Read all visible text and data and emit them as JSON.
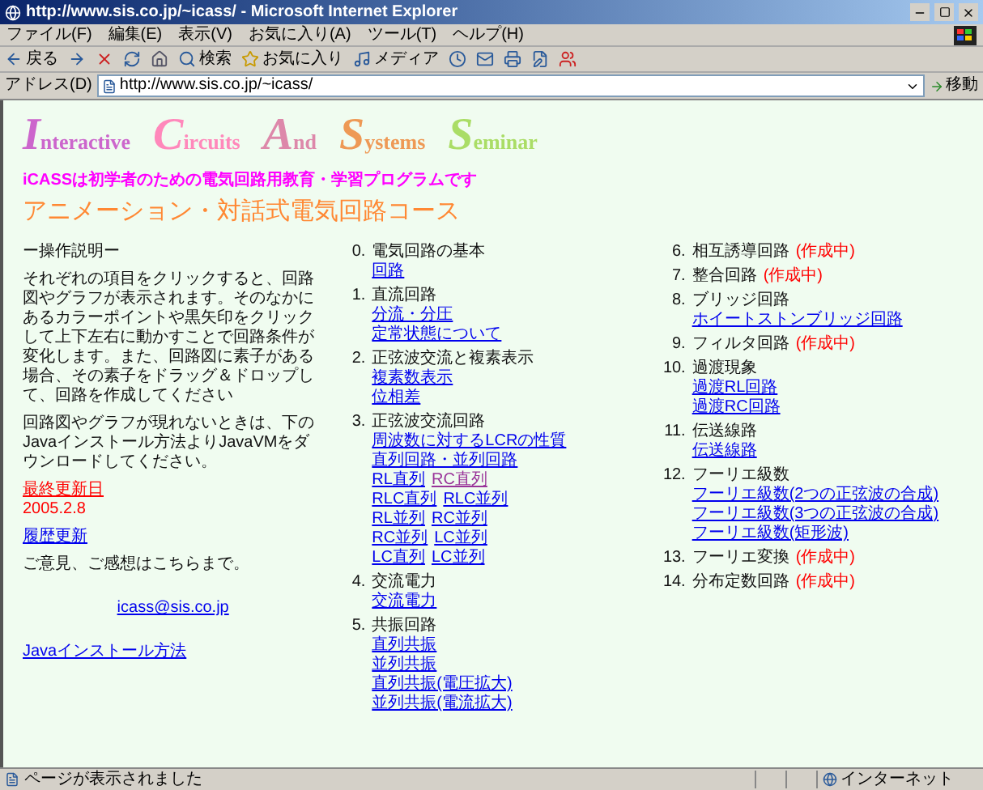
{
  "window": {
    "title": "http://www.sis.co.jp/~icass/ - Microsoft Internet Explorer"
  },
  "menu": [
    "ファイル(F)",
    "編集(E)",
    "表示(V)",
    "お気に入り(A)",
    "ツール(T)",
    "ヘルプ(H)"
  ],
  "toolbar": [
    {
      "kind": "back",
      "label": "戻る"
    },
    {
      "kind": "forward"
    },
    {
      "kind": "stop"
    },
    {
      "kind": "refresh"
    },
    {
      "kind": "home"
    },
    {
      "kind": "search",
      "label": "検索"
    },
    {
      "kind": "favorites",
      "label": "お気に入り"
    },
    {
      "kind": "media",
      "label": "メディア"
    },
    {
      "kind": "history"
    },
    {
      "kind": "mail"
    },
    {
      "kind": "print"
    },
    {
      "kind": "edit"
    },
    {
      "kind": "messenger"
    }
  ],
  "address": {
    "label": "アドレス(D)",
    "value": "http://www.sis.co.jp/~icass/",
    "go": "移動"
  },
  "page": {
    "logo": [
      {
        "word": "Interactive",
        "color": "#cc66cc"
      },
      {
        "word": "Circuits",
        "color": "#ff88bb"
      },
      {
        "word": "And",
        "color": "#dd88aa"
      },
      {
        "word": "Systems",
        "color": "#ee9955"
      },
      {
        "word": "Seminar",
        "color": "#aadd66"
      }
    ],
    "tagline": "iCASSは初学者のための電気回路用教育・学習プログラムです",
    "heading": "アニメーション・対話式電気回路コース",
    "left": [
      {
        "kind": "text",
        "text": "ー操作説明ー"
      },
      {
        "kind": "text",
        "text": "それぞれの項目をクリックすると、回路図やグラフが表示されます。そのなかにあるカラーポイントや黒矢印をクリックして上下左右に動かすことで回路条件が変化します。また、回路図に素子がある場合、その素子をドラッグ＆ドロップして、回路を作成してください"
      },
      {
        "kind": "text",
        "text": "回路図やグラフが現れないときは、下のJavaインストール方法よりJavaVMをダウンロードしてください。"
      },
      {
        "kind": "red",
        "text": "最終更新日"
      },
      {
        "kind": "red_small",
        "text": "2005.2.8"
      },
      {
        "kind": "link",
        "text": "履歴更新"
      },
      {
        "kind": "text",
        "text": "ご意見、ご感想はこちらまで。"
      },
      {
        "kind": "mail",
        "text": "icass@sis.co.jp"
      },
      {
        "kind": "link",
        "text": "Javaインストール方法"
      }
    ],
    "sections": [
      {
        "number": "0.",
        "title": "電気回路の基本",
        "links": [
          [
            {
              "text": "回路",
              "visited": false
            }
          ]
        ]
      },
      {
        "number": "1.",
        "title": "直流回路",
        "links": [
          [
            {
              "text": "分流・分圧",
              "visited": false
            }
          ],
          [
            {
              "text": "定常状態について",
              "visited": false
            }
          ]
        ]
      },
      {
        "number": "2.",
        "title": "正弦波交流と複素表示",
        "links": [
          [
            {
              "text": "複素数表示",
              "visited": false
            }
          ],
          [
            {
              "text": "位相差",
              "visited": false
            }
          ]
        ]
      },
      {
        "number": "3.",
        "title": "正弦波交流回路",
        "links": [
          [
            {
              "text": "周波数に対するLCRの性質",
              "visited": false
            }
          ],
          [
            {
              "text": "直列回路・並列回路",
              "visited": false
            }
          ],
          [
            {
              "text": "RL直列",
              "visited": false
            },
            {
              "text": "RC直列",
              "visited": true
            }
          ],
          [
            {
              "text": "RLC直列",
              "visited": false
            },
            {
              "text": "RLC並列",
              "visited": false
            }
          ],
          [
            {
              "text": "RL並列",
              "visited": false
            },
            {
              "text": "RC並列",
              "visited": false
            }
          ],
          [
            {
              "text": "RC並列",
              "visited": false
            },
            {
              "text": "LC並列",
              "visited": false
            }
          ],
          [
            {
              "text": "LC直列",
              "visited": false
            },
            {
              "text": "LC並列",
              "visited": false
            }
          ]
        ]
      },
      {
        "number": "4.",
        "title": "交流電力",
        "links": [
          [
            {
              "text": "交流電力",
              "visited": false
            }
          ]
        ]
      },
      {
        "number": "5.",
        "title": "共振回路",
        "links": [
          [
            {
              "text": "直列共振",
              "visited": false
            }
          ],
          [
            {
              "text": "並列共振",
              "visited": false
            }
          ],
          [
            {
              "text": "直列共振(電圧拡大)",
              "visited": false
            }
          ],
          [
            {
              "text": "並列共振(電流拡大)",
              "visited": false
            }
          ]
        ]
      },
      {
        "number": "6.",
        "title": "相互誘導回路",
        "note": "(作成中)"
      },
      {
        "number": "7.",
        "title": "整合回路",
        "note": "(作成中)"
      },
      {
        "number": "8.",
        "title": "ブリッジ回路",
        "links": [
          [
            {
              "text": "ホイートストンブリッジ回路",
              "visited": false
            }
          ]
        ]
      },
      {
        "number": "9.",
        "title": "フィルタ回路",
        "note": "(作成中)"
      },
      {
        "number": "10.",
        "title": "過渡現象",
        "links": [
          [
            {
              "text": "過渡RL回路",
              "visited": false
            }
          ],
          [
            {
              "text": "過渡RC回路",
              "visited": false
            }
          ]
        ]
      },
      {
        "number": "11.",
        "title": "伝送線路",
        "links": [
          [
            {
              "text": "伝送線路",
              "visited": false
            }
          ]
        ]
      },
      {
        "number": "12.",
        "title": "フーリエ級数",
        "links": [
          [
            {
              "text": "フーリエ級数(2つの正弦波の合成)",
              "visited": false
            }
          ],
          [
            {
              "text": "フーリエ級数(3つの正弦波の合成)",
              "visited": false
            }
          ],
          [
            {
              "text": "フーリエ級数(矩形波)",
              "visited": false
            }
          ]
        ]
      },
      {
        "number": "13.",
        "title": "フーリエ変換",
        "note": "(作成中)"
      },
      {
        "number": "14.",
        "title": "分布定数回路",
        "note": "(作成中)"
      }
    ]
  },
  "status_bar": {
    "text": "ページが表示されました",
    "zone": "インターネット"
  }
}
